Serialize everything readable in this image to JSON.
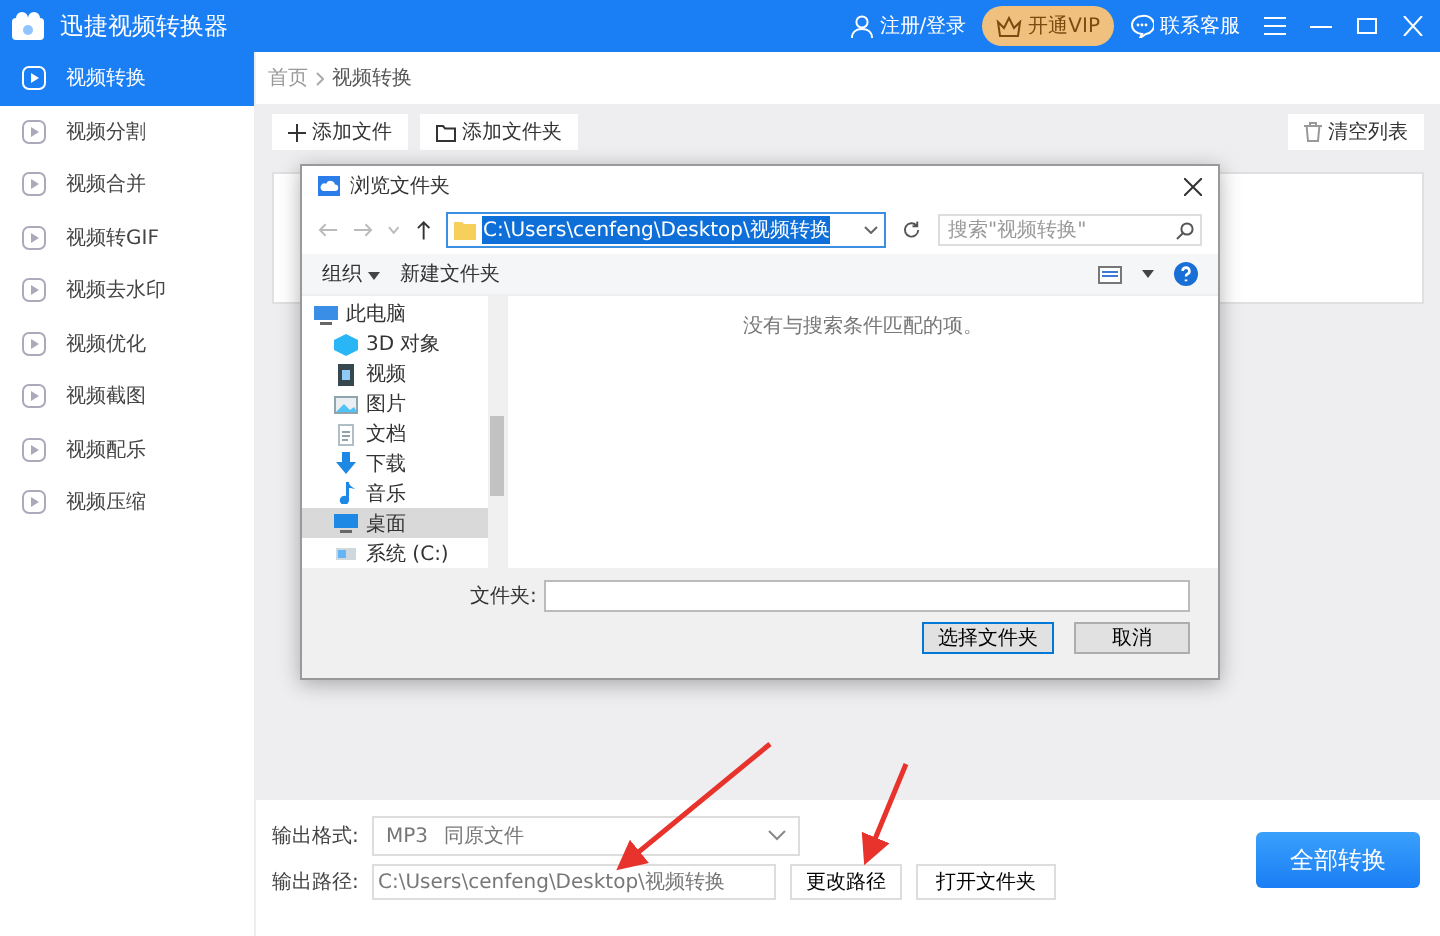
{
  "window": {
    "title": "迅捷视频转换器"
  },
  "header": {
    "login": "注册/登录",
    "vip": "开通VIP",
    "support": "联系客服"
  },
  "sidebar": {
    "items": [
      {
        "label": "视频转换",
        "selected": true
      },
      {
        "label": "视频分割",
        "selected": false
      },
      {
        "label": "视频合并",
        "selected": false
      },
      {
        "label": "视频转GIF",
        "selected": false
      },
      {
        "label": "视频去水印",
        "selected": false
      },
      {
        "label": "视频优化",
        "selected": false
      },
      {
        "label": "视频截图",
        "selected": false
      },
      {
        "label": "视频配乐",
        "selected": false
      },
      {
        "label": "视频压缩",
        "selected": false
      }
    ]
  },
  "breadcrumb": [
    "首页",
    "视频转换"
  ],
  "toolbar": {
    "add_file": "添加文件",
    "add_folder": "添加文件夹",
    "clear": "清空列表"
  },
  "dialog": {
    "title": "浏览文件夹",
    "address": "C:\\Users\\cenfeng\\Desktop\\视频转换",
    "search": {
      "placeholder": "搜索\"视频转换\""
    },
    "organize": "组织",
    "new_folder": "新建文件夹",
    "empty_message": "没有与搜索条件匹配的项。",
    "tree": [
      {
        "label": "此电脑",
        "kind": "computer",
        "selected": false,
        "children": [
          {
            "label": "3D 对象",
            "kind": "cube",
            "selected": false
          },
          {
            "label": "视频",
            "kind": "video",
            "selected": false
          },
          {
            "label": "图片",
            "kind": "picture",
            "selected": false
          },
          {
            "label": "文档",
            "kind": "document",
            "selected": false
          },
          {
            "label": "下载",
            "kind": "download",
            "selected": false
          },
          {
            "label": "音乐",
            "kind": "music",
            "selected": false
          },
          {
            "label": "桌面",
            "kind": "desktop",
            "selected": true
          },
          {
            "label": "系统 (C:)",
            "kind": "drive",
            "selected": false
          }
        ]
      }
    ],
    "folder_label": "文件夹:",
    "ok": "选择文件夹",
    "cancel": "取消"
  },
  "output": {
    "format_label": "输出格式:",
    "format": "MP3",
    "format_detail": "同原文件",
    "path_label": "输出路径:",
    "path": "C:\\Users\\cenfeng\\Desktop\\视频转换",
    "change_path": "更改路径",
    "open_folder": "打开文件夹",
    "convert_all": "全部转换"
  }
}
